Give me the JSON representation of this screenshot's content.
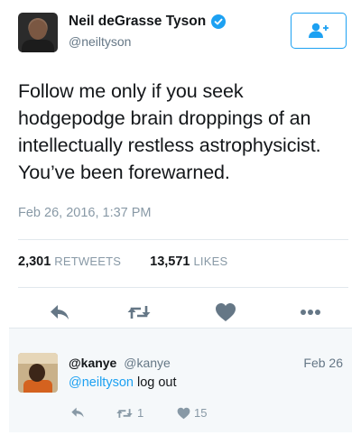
{
  "tweet": {
    "author": {
      "name": "Neil deGrasse Tyson",
      "handle": "@neiltyson",
      "verified": true
    },
    "text": "Follow me only if you seek hodgepodge brain droppings of an intellectually restless astrophysicist. You’ve been forewarned.",
    "timestamp": "Feb 26, 2016, 1:37 PM",
    "stats": {
      "retweets_count": "2,301",
      "retweets_label": "RETWEETS",
      "likes_count": "13,571",
      "likes_label": "LIKES"
    }
  },
  "reply": {
    "name": "@kanye",
    "handle": "@kanye",
    "date": "Feb 26",
    "mention": "@neiltyson",
    "text": " log out",
    "retweet_count": "1",
    "like_count": "15"
  },
  "colors": {
    "accent": "#1da1f2",
    "muted": "#8899a6",
    "icon": "#657786",
    "reply_bg": "#f5f8fa"
  }
}
